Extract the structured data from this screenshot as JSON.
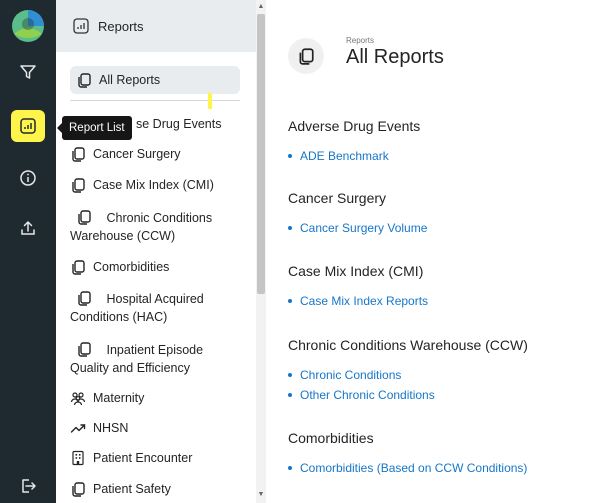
{
  "tooltip": "Report List",
  "nav": {
    "header": "Reports",
    "items": [
      {
        "label": "All Reports"
      },
      {
        "label": "se Drug Events"
      },
      {
        "label": "Cancer Surgery"
      },
      {
        "label": "Case Mix Index (CMI)"
      },
      {
        "label": "Chronic Conditions Warehouse (CCW)"
      },
      {
        "label": "Comorbidities"
      },
      {
        "label": "Hospital Acquired Conditions (HAC)"
      },
      {
        "label": "Inpatient Episode Quality and Efficiency"
      },
      {
        "label": "Maternity"
      },
      {
        "label": "NHSN"
      },
      {
        "label": "Patient Encounter"
      },
      {
        "label": "Patient Safety"
      }
    ]
  },
  "main": {
    "breadcrumb": "Reports",
    "title": "All Reports",
    "sections": [
      {
        "title": "Adverse Drug Events",
        "links": [
          "ADE Benchmark"
        ]
      },
      {
        "title": "Cancer Surgery",
        "links": [
          "Cancer Surgery Volume"
        ]
      },
      {
        "title": "Case Mix Index (CMI)",
        "links": [
          "Case Mix Index Reports"
        ]
      },
      {
        "title": "Chronic Conditions Warehouse (CCW)",
        "links": [
          "Chronic Conditions",
          "Other Chronic Conditions"
        ]
      },
      {
        "title": "Comorbidities",
        "links": [
          "Comorbidities (Based on CCW Conditions)"
        ]
      }
    ]
  },
  "colors": {
    "rail": "#1f2a30",
    "highlight": "#fff54a",
    "link": "#1677c9",
    "panel_header": "#e9ecef"
  },
  "icons": [
    "app-logo-icon",
    "filter-icon",
    "report-list-icon",
    "info-icon",
    "upload-icon",
    "logout-icon",
    "reports-icon",
    "copy-icon",
    "people-icon",
    "trend-icon",
    "building-icon"
  ]
}
